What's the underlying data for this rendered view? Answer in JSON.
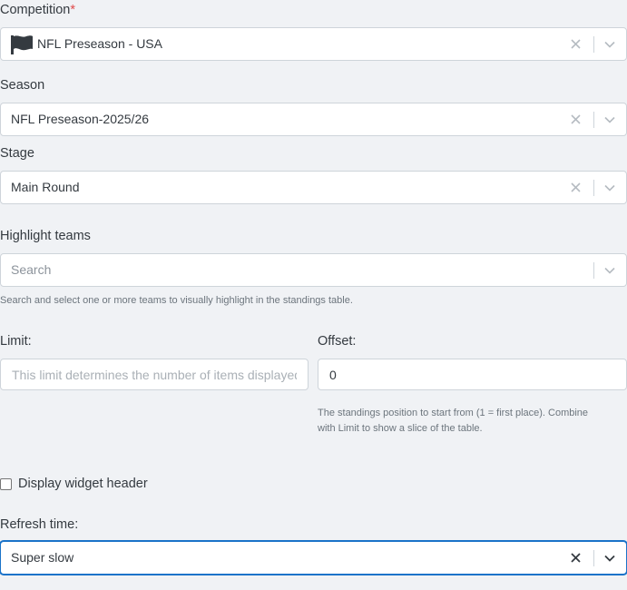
{
  "competition": {
    "label": "Competition",
    "required_mark": "*",
    "value": "NFL Preseason - USA",
    "icon": "flag-icon"
  },
  "season": {
    "label": "Season",
    "value": "NFL Preseason-2025/26"
  },
  "stage": {
    "label": "Stage",
    "value": "Main Round"
  },
  "highlight_teams": {
    "label": "Highlight teams",
    "placeholder": "Search",
    "help": "Search and select one or more teams to visually highlight in the standings table."
  },
  "limit": {
    "label": "Limit:",
    "value": "",
    "placeholder": "This limit determines the number of items displayed"
  },
  "offset": {
    "label": "Offset:",
    "value": "0",
    "help_line1": "The standings position to start from (1 = first place). Combine",
    "help_line2": "with Limit to show a slice of the table."
  },
  "display_header": {
    "label": "Display widget header",
    "checked": false
  },
  "refresh_time": {
    "label": "Refresh time:",
    "value": "Super slow"
  },
  "colors": {
    "background": "#f0f2f5",
    "border": "#ced4da",
    "focus": "#1a73c9",
    "required": "#e04b4b",
    "help_text": "#6c757d"
  }
}
